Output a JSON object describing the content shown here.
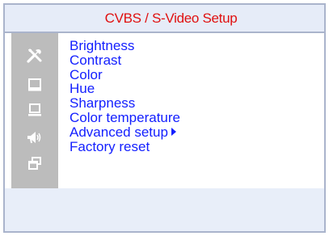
{
  "window": {
    "title": "CVBS / S-Video Setup"
  },
  "sidebar": {
    "icons": [
      {
        "name": "tools-icon"
      },
      {
        "name": "display-icon"
      },
      {
        "name": "laptop-icon"
      },
      {
        "name": "speaker-icon"
      },
      {
        "name": "windows-icon"
      }
    ]
  },
  "menu": {
    "items": [
      {
        "label": "Brightness"
      },
      {
        "label": "Contrast"
      },
      {
        "label": "Color"
      },
      {
        "label": "Hue"
      },
      {
        "label": "Sharpness"
      },
      {
        "label": "Color temperature"
      },
      {
        "label": "Advanced setup",
        "has_submenu": true
      },
      {
        "label": "Factory reset"
      }
    ]
  },
  "colors": {
    "title_text": "#e01010",
    "menu_text": "#1420ff",
    "sidebar_bg": "#bcbcbc",
    "frame_bg": "#e8eef9"
  }
}
